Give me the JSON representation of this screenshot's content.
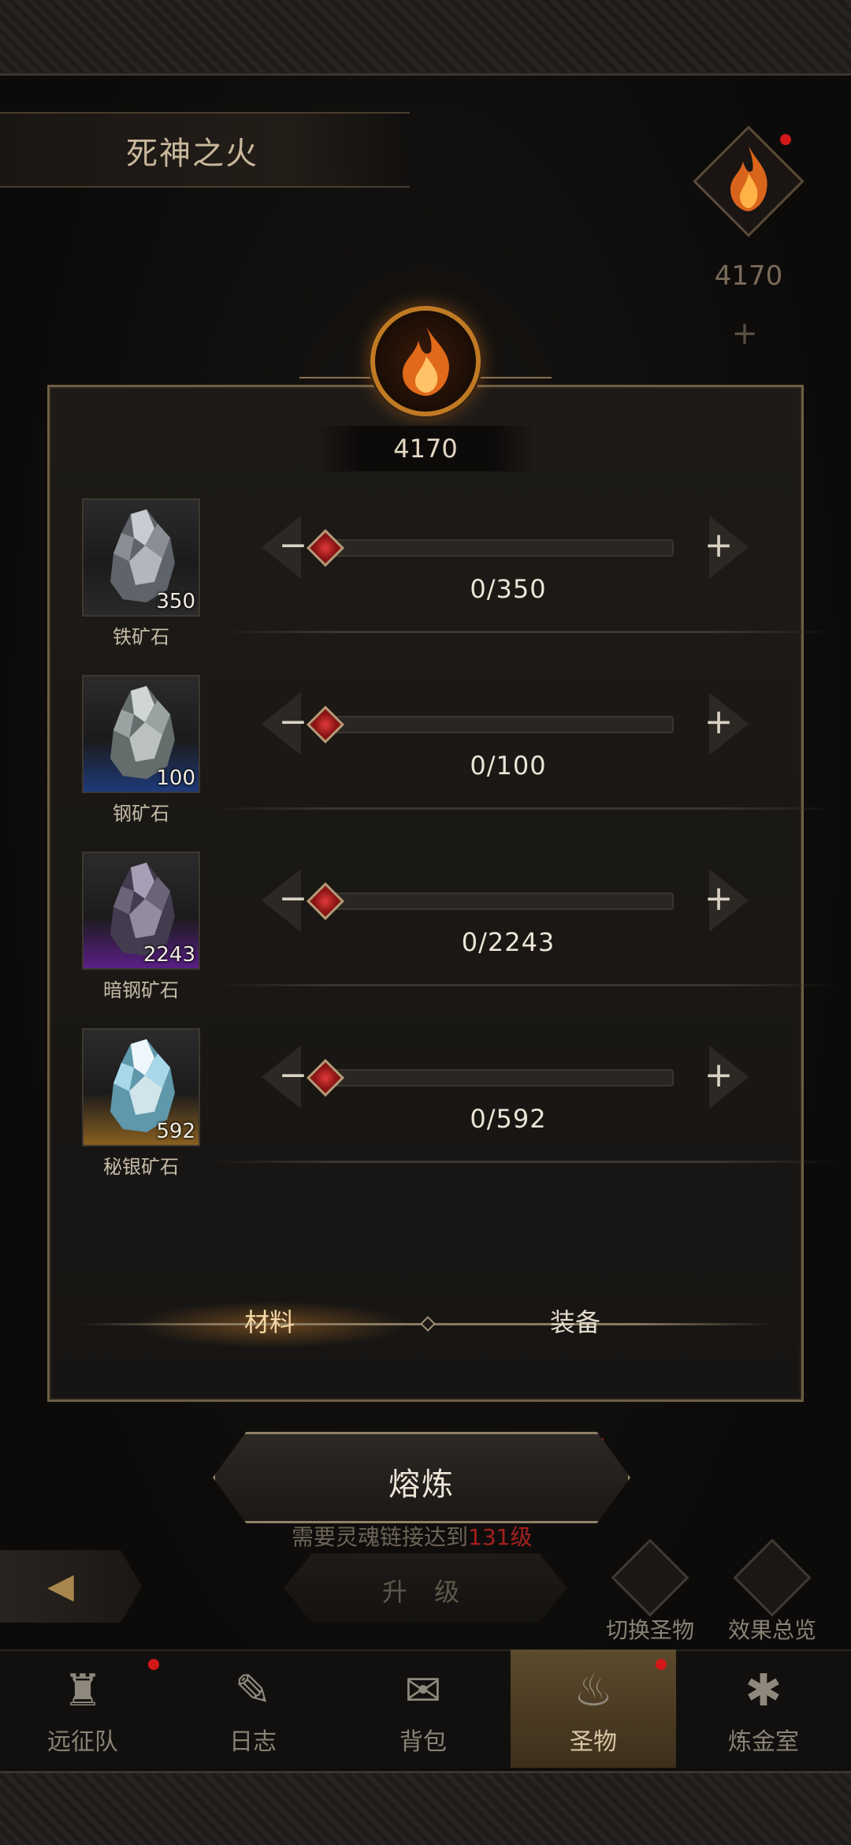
{
  "header": {
    "title": "死神之火",
    "artifact_count": "4170"
  },
  "panel": {
    "center_count": "4170",
    "rows": [
      {
        "name": "铁矿石",
        "stock": "350",
        "progress": "0/350",
        "value": 0,
        "max": 350,
        "slot_color": "#2a2a2a"
      },
      {
        "name": "钢矿石",
        "stock": "100",
        "progress": "0/100",
        "value": 0,
        "max": 100,
        "slot_color": "#1e3a7a"
      },
      {
        "name": "暗钢矿石",
        "stock": "2243",
        "progress": "0/2243",
        "value": 0,
        "max": 2243,
        "slot_color": "#5a1f86"
      },
      {
        "name": "秘银矿石",
        "stock": "592",
        "progress": "0/592",
        "value": 0,
        "max": 592,
        "slot_color": "#8a6020"
      }
    ],
    "tabs": {
      "materials": "材料",
      "equipment": "装备"
    }
  },
  "actions": {
    "smelt": "熔炼",
    "requirement_prefix": "需要灵魂链接达到",
    "requirement_level": "131级",
    "upgrade": "升 级",
    "switch_artifact": "切换圣物",
    "effect_overview": "效果总览"
  },
  "nav": {
    "items": [
      "远征队",
      "日志",
      "背包",
      "圣物",
      "炼金室"
    ],
    "active": 3
  },
  "colors": {
    "accent": "#c07a24",
    "knob": "#d62828"
  }
}
